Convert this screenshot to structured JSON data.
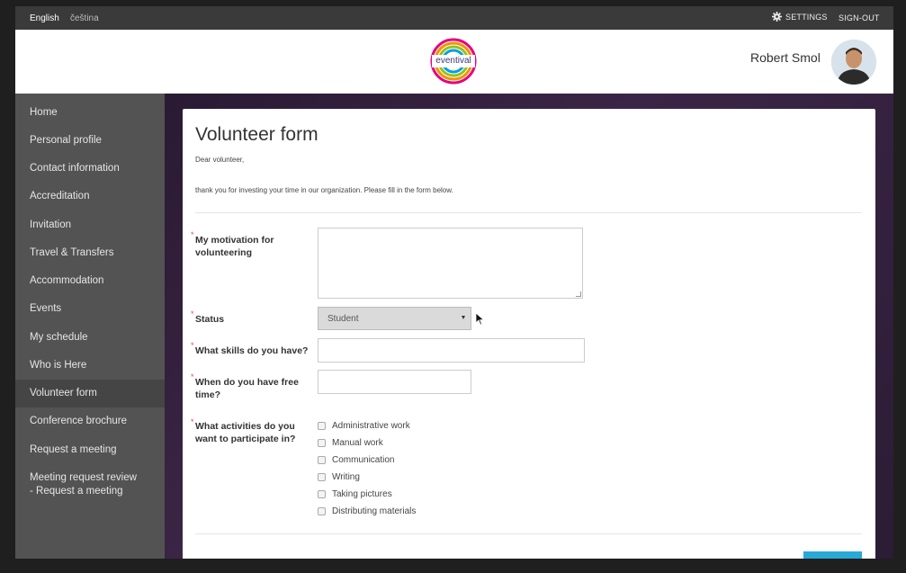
{
  "topbar": {
    "languages": [
      "English",
      "čeština"
    ],
    "settings_label": "SETTINGS",
    "signout_label": "SIGN-OUT"
  },
  "header": {
    "logo_text": "eventival",
    "user_name": "Robert Smol"
  },
  "sidebar": {
    "items": [
      {
        "label": "Home"
      },
      {
        "label": "Personal profile"
      },
      {
        "label": "Contact information"
      },
      {
        "label": "Accreditation"
      },
      {
        "label": "Invitation"
      },
      {
        "label": "Travel & Transfers"
      },
      {
        "label": "Accommodation"
      },
      {
        "label": "Events"
      },
      {
        "label": "My schedule"
      },
      {
        "label": "Who is Here"
      },
      {
        "label": "Volunteer form",
        "active": true
      },
      {
        "label": "Conference brochure"
      },
      {
        "label": "Request a meeting"
      },
      {
        "label": "Meeting request review - Request a meeting"
      }
    ]
  },
  "form": {
    "title": "Volunteer form",
    "intro_line1": "Dear volunteer,",
    "intro_line2": "thank you for investing your time in our organization. Please fill in the form below.",
    "required_mark": "*",
    "fields": {
      "motivation_label": "My motivation for volunteering",
      "motivation_value": "",
      "status_label": "Status",
      "status_value": "Student",
      "skills_label": "What skills do you have?",
      "skills_value": "",
      "free_time_label": "When do you have free time?",
      "free_time_value": "",
      "activities_label": "What activities do you want to participate in?",
      "activities": [
        {
          "label": "Administrative work",
          "checked": false
        },
        {
          "label": "Manual work",
          "checked": false
        },
        {
          "label": "Communication",
          "checked": false
        },
        {
          "label": "Writing",
          "checked": false
        },
        {
          "label": "Taking pictures",
          "checked": false
        },
        {
          "label": "Distributing materials",
          "checked": false
        }
      ]
    }
  },
  "colors": {
    "topbar": "#3a3a3a",
    "sidebar": "#535353",
    "sidebar_active": "#454545",
    "background": "#3b2546",
    "required": "#d9534f",
    "submit": "#29a9d8"
  }
}
